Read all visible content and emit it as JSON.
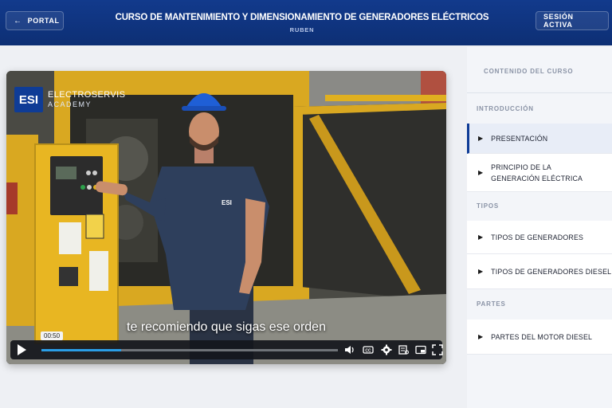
{
  "header": {
    "portal_label": "PORTAL",
    "course_title": "CURSO DE MANTENIMIENTO Y DIMENSIONAMIENTO DE GENERADORES ELÉCTRICOS",
    "user_name": "RUBEN",
    "session_label": "SESIÓN ACTIVA",
    "back_icon": "arrow-left-icon",
    "colors": {
      "header_bg": "#123a8c",
      "accent": "#0f3c96",
      "progress": "#2a9ee6"
    }
  },
  "video": {
    "brand_logo": "ESI",
    "brand_name": "ELECTROSERVIS",
    "brand_sub": "ACADEMY",
    "shirt_logo": "ESI",
    "subtitle": "te recomiendo que sigas ese orden",
    "current_time": "00:50",
    "progress_fraction": 0.27,
    "icons": [
      "play-icon",
      "volume-icon",
      "captions-icon",
      "settings-icon",
      "transcript-icon",
      "pip-icon",
      "fullscreen-icon"
    ]
  },
  "sidebar": {
    "title": "CONTENIDO DEL CURSO",
    "sections": [
      {
        "label": "INTRODUCCIÓN"
      },
      {
        "label": "TIPOS"
      },
      {
        "label": "PARTES"
      }
    ],
    "lessons": [
      {
        "label": "PRESENTACIÓN",
        "active": true
      },
      {
        "label_line1": "PRINCIPIO DE LA",
        "label_line2": "GENERACIÓN ELÉCTRICA"
      },
      {
        "label": "TIPOS DE GENERADORES"
      },
      {
        "label": "TIPOS DE GENERADORES DIESEL"
      },
      {
        "label": "PARTES DEL MOTOR DIESEL"
      }
    ]
  }
}
